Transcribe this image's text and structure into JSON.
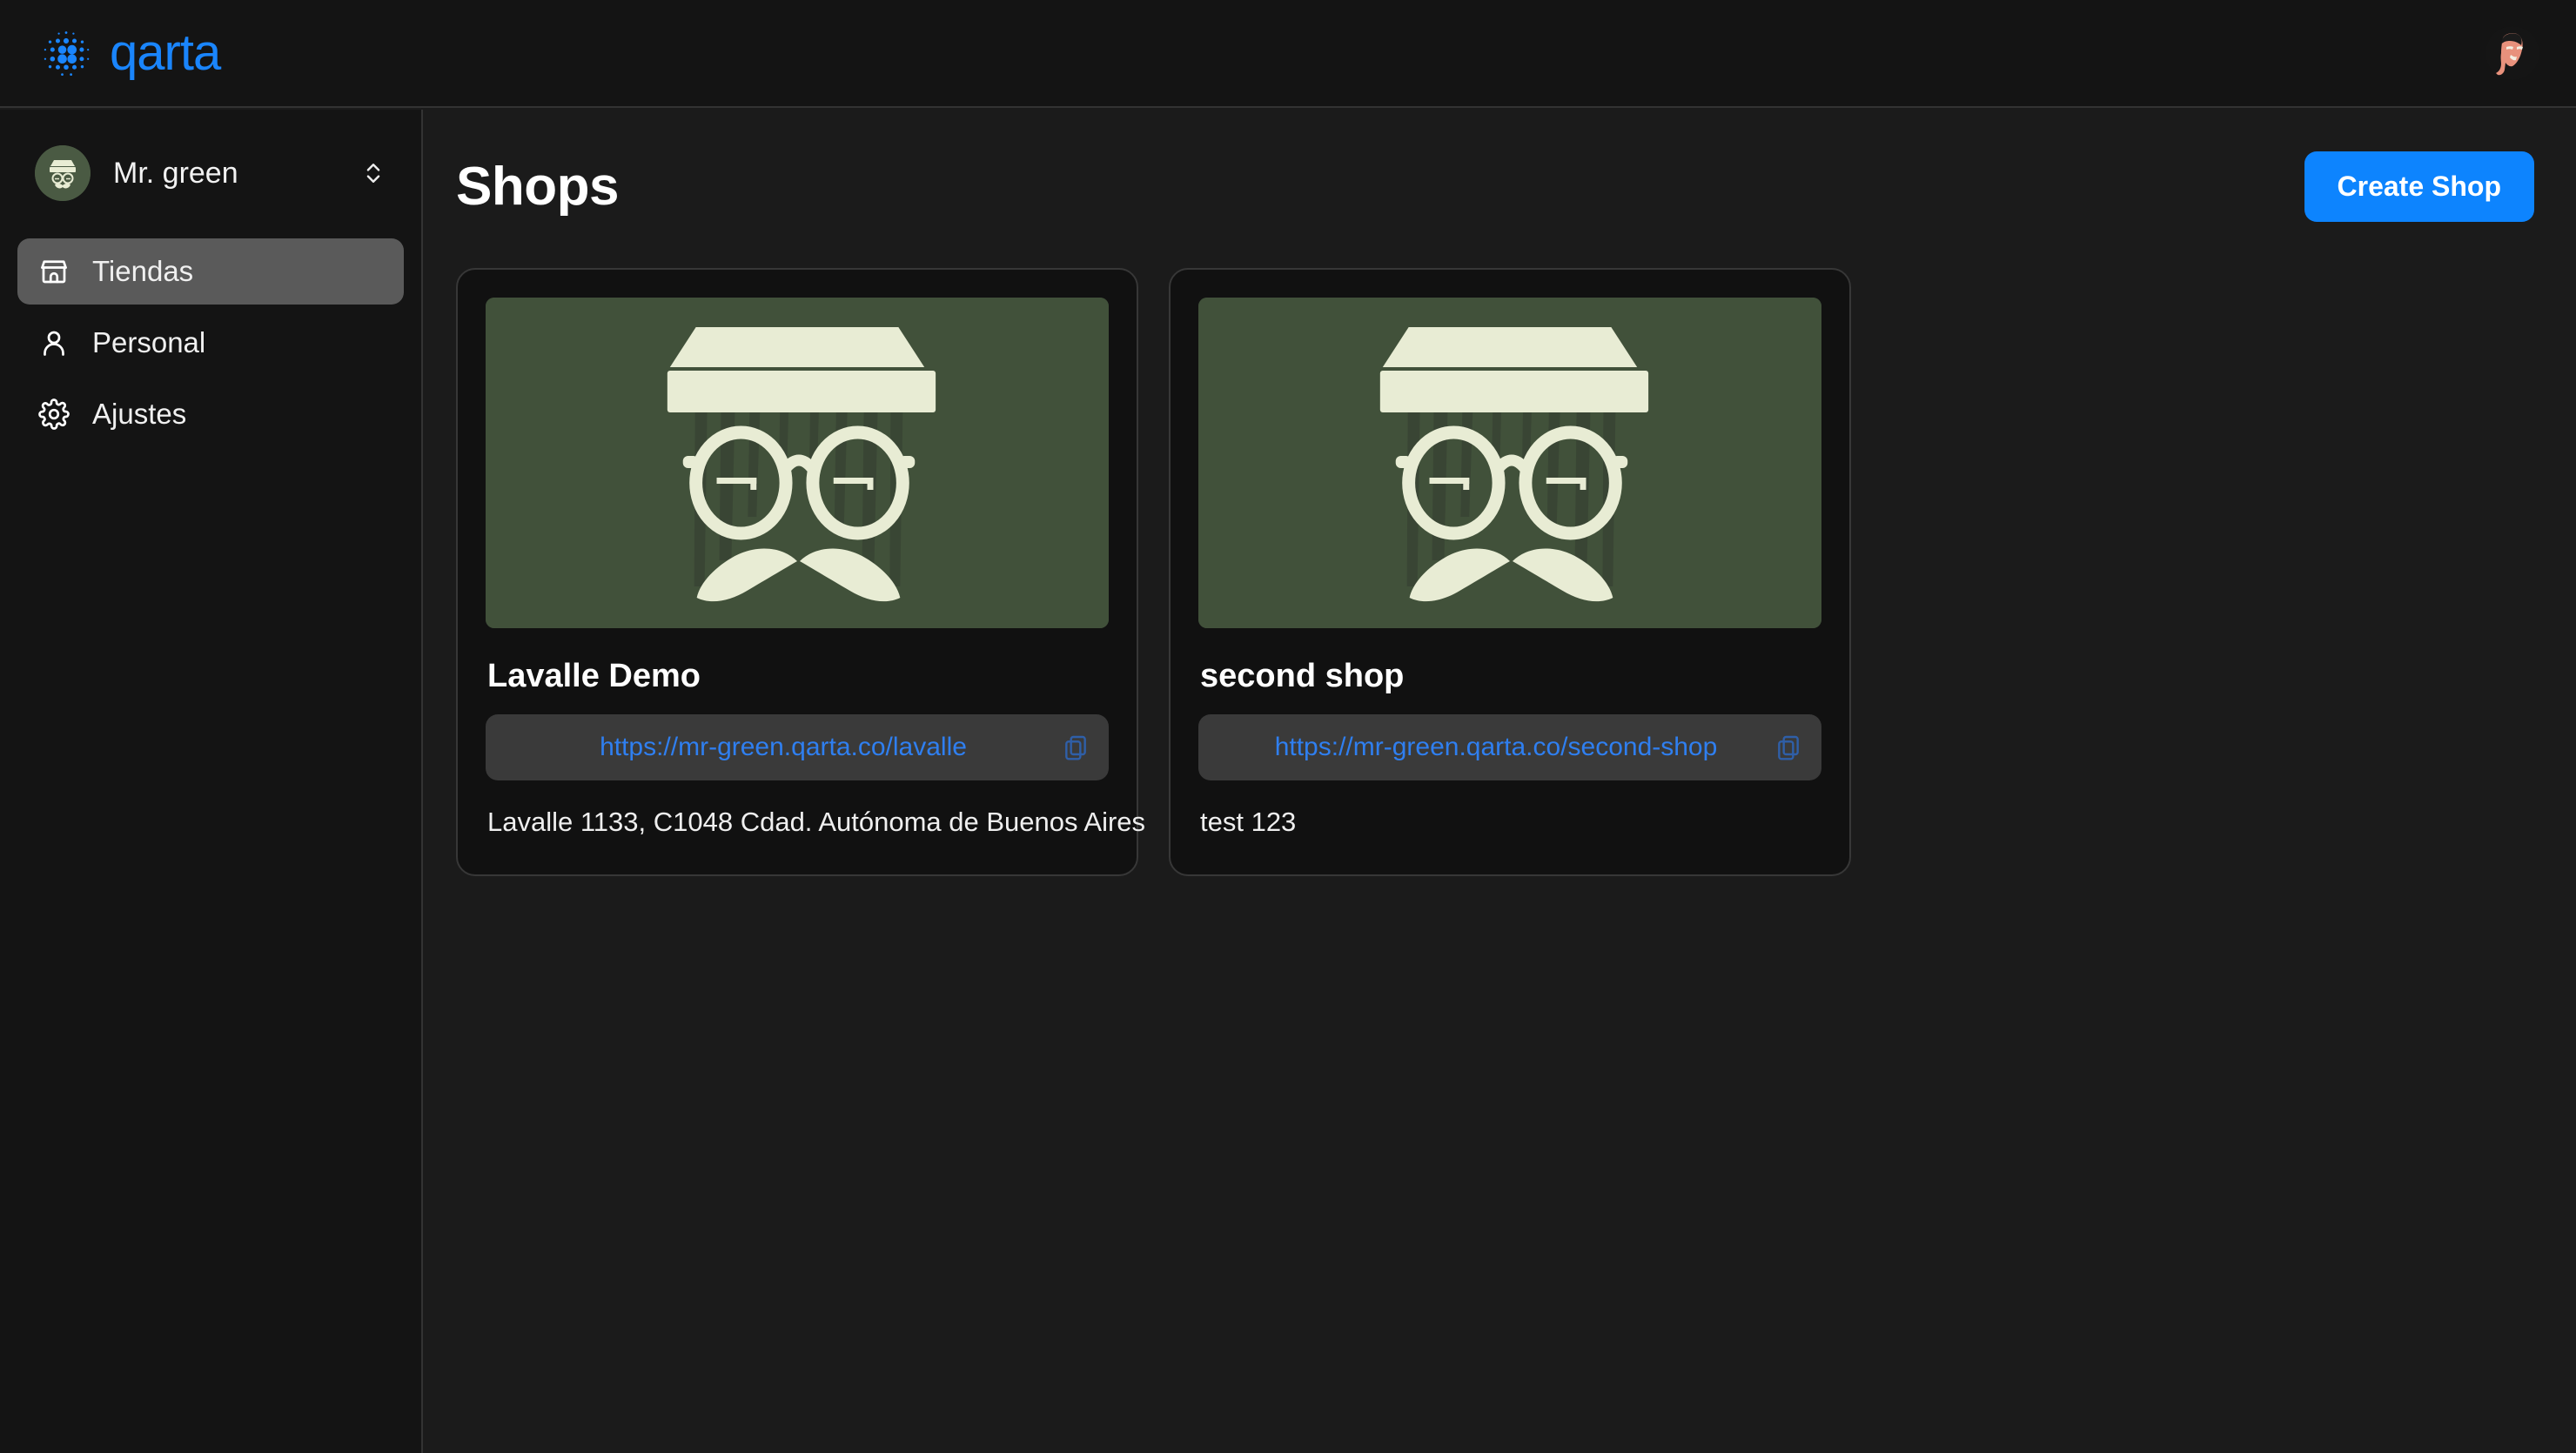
{
  "topbar": {
    "brand_name": "qarta",
    "logo_icon": "dot-grid-icon",
    "brand_color": "#1a85fc",
    "user_avatar_icon": "user-avatar"
  },
  "sidebar": {
    "org": {
      "name": "Mr. green",
      "avatar_icon": "mr-green-logo-icon",
      "switcher_icon": "chevron-up-down-icon"
    },
    "items": [
      {
        "label": "Tiendas",
        "icon": "store-icon",
        "active": true
      },
      {
        "label": "Personal",
        "icon": "user-icon",
        "active": false
      },
      {
        "label": "Ajustes",
        "icon": "gear-icon",
        "active": false
      }
    ]
  },
  "main": {
    "title": "Shops",
    "create_button": "Create Shop",
    "create_button_color": "#0d84fe",
    "shops": [
      {
        "name": "Lavalle Demo",
        "url": "https://mr-green.qarta.co/lavalle",
        "address": "Lavalle 1133, C1048 Cdad. Autónoma de Buenos Aires",
        "copy_icon": "copy-icon",
        "image_icon": "mr-green-logo-image",
        "image_bg": "#41513a",
        "image_fg": "#e8ecd4"
      },
      {
        "name": "second shop",
        "url": "https://mr-green.qarta.co/second-shop",
        "address": "test 123",
        "copy_icon": "copy-icon",
        "image_icon": "mr-green-logo-image",
        "image_bg": "#41513a",
        "image_fg": "#e8ecd4"
      }
    ]
  }
}
